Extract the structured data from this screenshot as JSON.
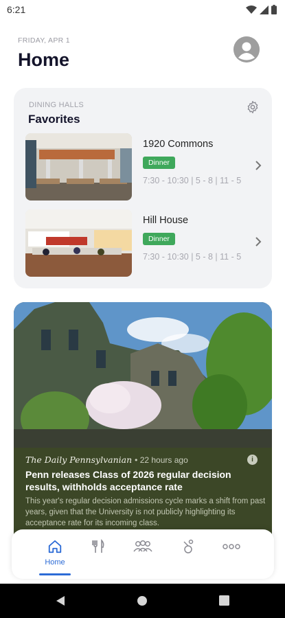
{
  "status_bar": {
    "time": "6:21"
  },
  "header": {
    "date": "FRIDAY, APR 1",
    "title": "Home"
  },
  "dining": {
    "caption": "DINING HALLS",
    "title": "Favorites",
    "halls": [
      {
        "name": "1920 Commons",
        "badge": "Dinner",
        "hours": "7:30 - 10:30 | 5 - 8 | 11 - 5"
      },
      {
        "name": "Hill House",
        "badge": "Dinner",
        "hours": "7:30 - 10:30 | 5 - 8 | 11 - 5"
      }
    ]
  },
  "news": {
    "source": "The Daily Pennsylvanian",
    "time": "• 22 hours ago",
    "headline": "Penn releases Class of 2026 regular decision results, withholds acceptance rate",
    "summary": "This year's regular decision admissions cycle marks a shift from past years, given that the University is not publicly highlighting its acceptance rate for its incoming class."
  },
  "tabs": [
    {
      "label": "Home",
      "icon": "home-icon",
      "active": true
    },
    {
      "label": "",
      "icon": "dining-icon"
    },
    {
      "label": "",
      "icon": "people-icon"
    },
    {
      "label": "",
      "icon": "laundry-icon"
    },
    {
      "label": "",
      "icon": "more-icon"
    }
  ],
  "colors": {
    "accent": "#2c6bd6",
    "badge": "#3fa85b",
    "news_bg": "#3c4727"
  }
}
